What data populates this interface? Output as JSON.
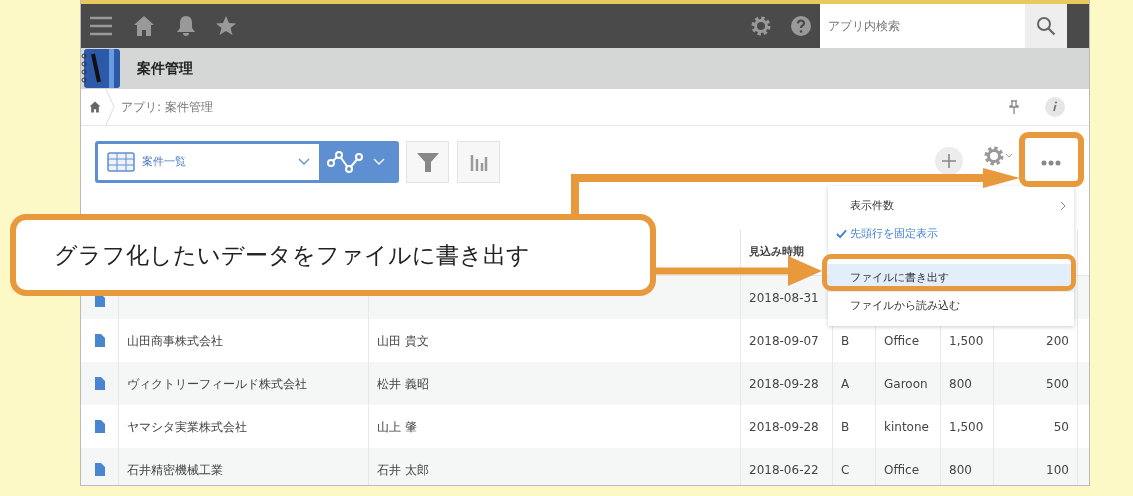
{
  "top_bar": {
    "search": {
      "placeholder": "アプリ内検索"
    }
  },
  "app": {
    "title": "案件管理"
  },
  "breadcrumb": {
    "text": "アプリ: 案件管理"
  },
  "toolbar": {
    "view": {
      "label": "案件一覧"
    }
  },
  "menu": {
    "items": [
      {
        "kind": "submenu",
        "label": "表示件数",
        "checked": false,
        "selected": false
      },
      {
        "kind": "toggle",
        "label": "先頭行を固定表示",
        "checked": true,
        "selected": false
      },
      {
        "kind": "divider"
      },
      {
        "kind": "action",
        "label": "ファイルに書き出す",
        "checked": false,
        "selected": true
      },
      {
        "kind": "action",
        "label": "ファイルから読み込む",
        "checked": false,
        "selected": false
      }
    ]
  },
  "table": {
    "columns": [
      null,
      null,
      {
        "label": "見込み時期"
      }
    ],
    "rows": [
      [
        null,
        null,
        "2018-08-31",
        null,
        null,
        null,
        null
      ],
      [
        "山田商事株式会社",
        "山田 貴文",
        "2018-09-07",
        "B",
        "Office",
        "1,500",
        "200"
      ],
      [
        "ヴィクトリーフィールド株式会社",
        "松井 義昭",
        "2018-09-28",
        "A",
        "Garoon",
        "800",
        "500"
      ],
      [
        "ヤマシタ実業株式会社",
        "山上 肇",
        "2018-09-28",
        "B",
        "kintone",
        "1,500",
        "50"
      ],
      [
        "石井精密機械工業",
        "石井 太郎",
        "2018-06-22",
        "C",
        "Office",
        "800",
        "100"
      ]
    ]
  },
  "callout": {
    "text": "グラフ化したいデータをファイルに書き出す"
  }
}
